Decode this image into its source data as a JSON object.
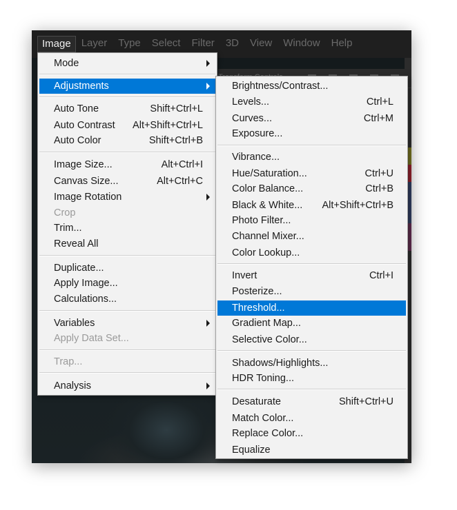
{
  "menubar": {
    "items": [
      "Image",
      "Layer",
      "Type",
      "Select",
      "Filter",
      "3D",
      "View",
      "Window",
      "Help"
    ]
  },
  "background": {
    "toolbar_text": "Transform Controls"
  },
  "image_menu": {
    "mode": {
      "label": "Mode"
    },
    "adjustments": {
      "label": "Adjustments"
    },
    "auto_tone": {
      "label": "Auto Tone",
      "shortcut": "Shift+Ctrl+L"
    },
    "auto_contrast": {
      "label": "Auto Contrast",
      "shortcut": "Alt+Shift+Ctrl+L"
    },
    "auto_color": {
      "label": "Auto Color",
      "shortcut": "Shift+Ctrl+B"
    },
    "image_size": {
      "label": "Image Size...",
      "shortcut": "Alt+Ctrl+I"
    },
    "canvas_size": {
      "label": "Canvas Size...",
      "shortcut": "Alt+Ctrl+C"
    },
    "image_rotation": {
      "label": "Image Rotation"
    },
    "crop": {
      "label": "Crop"
    },
    "trim": {
      "label": "Trim..."
    },
    "reveal_all": {
      "label": "Reveal All"
    },
    "duplicate": {
      "label": "Duplicate..."
    },
    "apply_image": {
      "label": "Apply Image..."
    },
    "calculations": {
      "label": "Calculations..."
    },
    "variables": {
      "label": "Variables"
    },
    "apply_data_set": {
      "label": "Apply Data Set..."
    },
    "trap": {
      "label": "Trap..."
    },
    "analysis": {
      "label": "Analysis"
    }
  },
  "adjustments_menu": {
    "brightness_contrast": {
      "label": "Brightness/Contrast..."
    },
    "levels": {
      "label": "Levels...",
      "shortcut": "Ctrl+L"
    },
    "curves": {
      "label": "Curves...",
      "shortcut": "Ctrl+M"
    },
    "exposure": {
      "label": "Exposure..."
    },
    "vibrance": {
      "label": "Vibrance..."
    },
    "hue_saturation": {
      "label": "Hue/Saturation...",
      "shortcut": "Ctrl+U"
    },
    "color_balance": {
      "label": "Color Balance...",
      "shortcut": "Ctrl+B"
    },
    "black_white": {
      "label": "Black & White...",
      "shortcut": "Alt+Shift+Ctrl+B"
    },
    "photo_filter": {
      "label": "Photo Filter..."
    },
    "channel_mixer": {
      "label": "Channel Mixer..."
    },
    "color_lookup": {
      "label": "Color Lookup..."
    },
    "invert": {
      "label": "Invert",
      "shortcut": "Ctrl+I"
    },
    "posterize": {
      "label": "Posterize..."
    },
    "threshold": {
      "label": "Threshold..."
    },
    "gradient_map": {
      "label": "Gradient Map..."
    },
    "selective_color": {
      "label": "Selective Color..."
    },
    "shadows_highlights": {
      "label": "Shadows/Highlights..."
    },
    "hdr_toning": {
      "label": "HDR Toning..."
    },
    "desaturate": {
      "label": "Desaturate",
      "shortcut": "Shift+Ctrl+U"
    },
    "match_color": {
      "label": "Match Color..."
    },
    "replace_color": {
      "label": "Replace Color..."
    },
    "equalize": {
      "label": "Equalize"
    }
  },
  "colors": {
    "highlight": "#0078d7",
    "menu_background": "#f2f2f2",
    "app_background": "#1f1f1f"
  }
}
